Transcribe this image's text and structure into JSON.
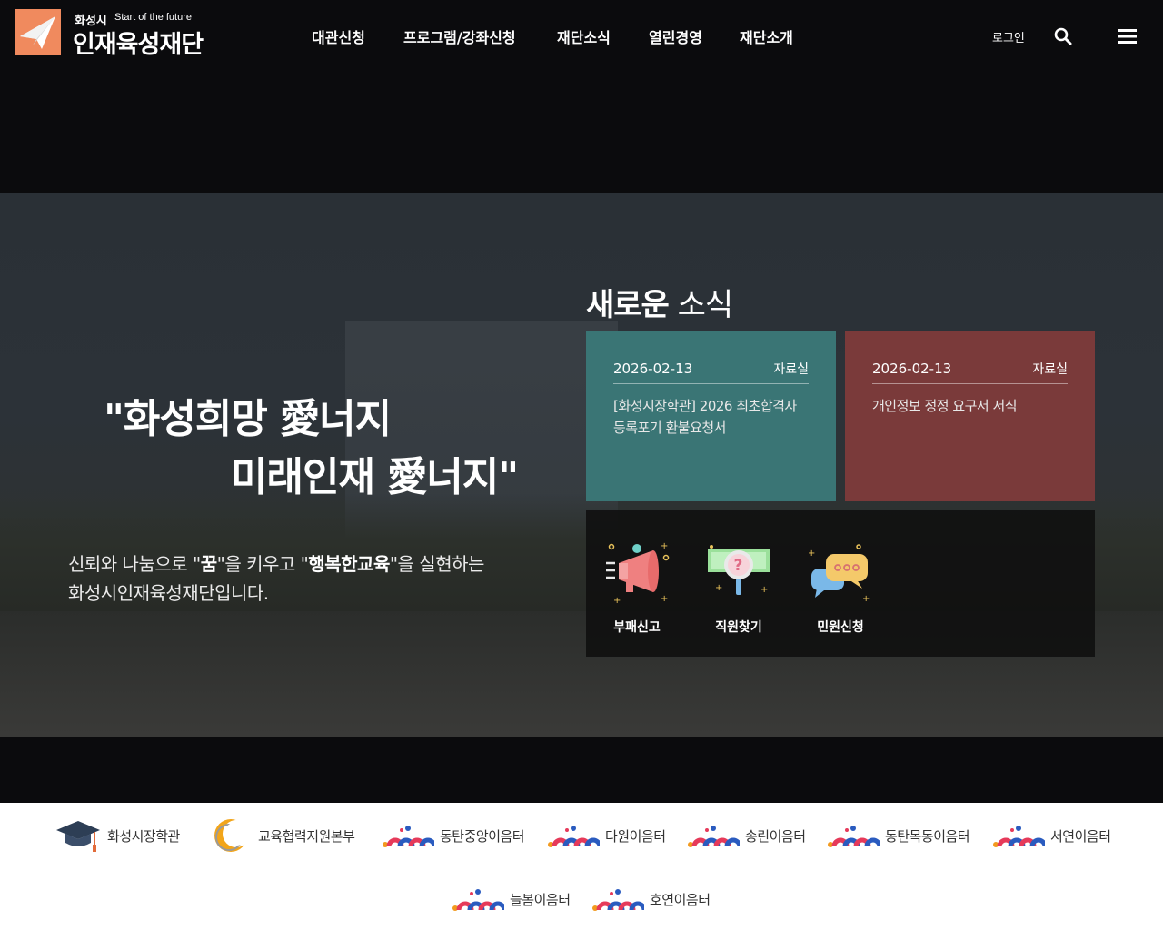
{
  "header": {
    "logo": {
      "small": "화성시",
      "tagline": "Start of the future",
      "name": "인재육성재단"
    },
    "nav": [
      {
        "label": "대관신청"
      },
      {
        "label": "프로그램/강좌신청"
      },
      {
        "label": "재단소식"
      },
      {
        "label": "열린경영"
      },
      {
        "label": "재단소개"
      }
    ],
    "login_label": "로그인",
    "icons": {
      "search": "search-icon",
      "menu": "hamburger-menu-icon"
    }
  },
  "hero": {
    "quote_line1": "\"화성희망 愛너지",
    "quote_line2": "미래인재 愛너지\"",
    "desc_line1_a": "신뢰와 나눔으로 \"",
    "desc_line1_b": "꿈",
    "desc_line1_c": "\"을 키우고 \"",
    "desc_line1_d": "행복한교육",
    "desc_line1_e": "\"을 실현하는",
    "desc_line2": "화성시인재육성재단입니다."
  },
  "news": {
    "title_bold": "새로운",
    "title_light": "소식",
    "cards": [
      {
        "date": "2026-02-13",
        "category": "자료실",
        "title": "[화성시장학관] 2026 최초합격자 등록포기 환불요청서",
        "color": "#3a7575"
      },
      {
        "date": "2026-02-13",
        "category": "자료실",
        "title": "개인정보 정정 요구서 서식",
        "color": "#7a3a3a"
      }
    ]
  },
  "quick_links": [
    {
      "label": "부패신고",
      "icon": "megaphone-icon"
    },
    {
      "label": "직원찾기",
      "icon": "question-search-icon"
    },
    {
      "label": "민원신청",
      "icon": "chat-bubbles-icon"
    }
  ],
  "family_sites": [
    {
      "label": "화성시장학관",
      "icon": "graduation-cap-icon"
    },
    {
      "label": "교육협력지원본부",
      "icon": "crescent-logo-icon"
    },
    {
      "label": "동탄중앙이음터",
      "icon": "eumteo-logo-icon"
    },
    {
      "label": "다원이음터",
      "icon": "eumteo-logo-icon"
    },
    {
      "label": "송린이음터",
      "icon": "eumteo-logo-icon"
    },
    {
      "label": "동탄목동이음터",
      "icon": "eumteo-logo-icon"
    },
    {
      "label": "서연이음터",
      "icon": "eumteo-logo-icon"
    },
    {
      "label": "늘봄이음터",
      "icon": "eumteo-logo-icon"
    },
    {
      "label": "호연이음터",
      "icon": "eumteo-logo-icon"
    }
  ]
}
